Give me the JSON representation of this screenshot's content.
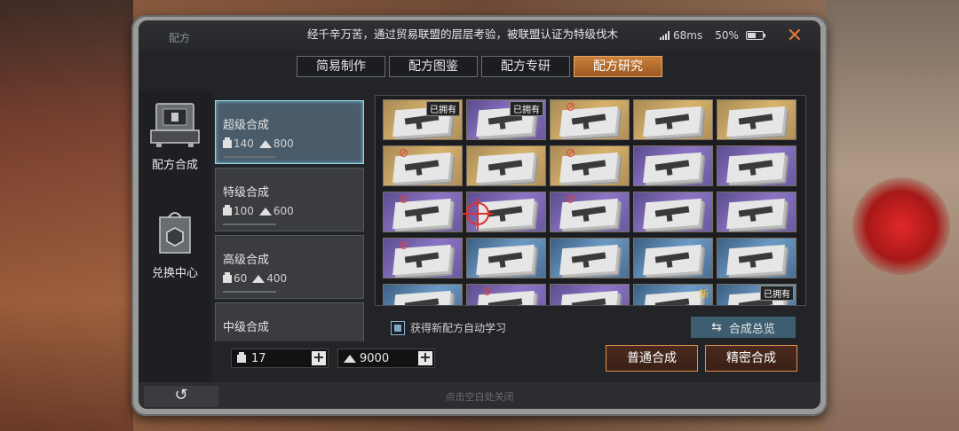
{
  "app": {
    "title": "配方"
  },
  "ticker": "经千辛万苦，通过贸易联盟的层层考验，被联盟认证为特级伐木",
  "status": {
    "ping": "68ms",
    "battery": "50%"
  },
  "close_symbol": "✕",
  "tabs": [
    {
      "label": "简易制作",
      "active": false
    },
    {
      "label": "配方图鉴",
      "active": false
    },
    {
      "label": "配方专研",
      "active": false
    },
    {
      "label": "配方研究",
      "active": true
    }
  ],
  "leftnav": [
    {
      "label": "配方合成",
      "icon": "crafting-machine-icon"
    },
    {
      "label": "兑换中心",
      "icon": "shopping-bag-icon"
    }
  ],
  "recipes": [
    {
      "title": "超级合成",
      "box": "140",
      "pile": "800",
      "active": true
    },
    {
      "title": "特级合成",
      "box": "100",
      "pile": "600",
      "active": false
    },
    {
      "title": "高级合成",
      "box": "60",
      "pile": "400",
      "active": false
    },
    {
      "title": "中级合成",
      "box": "",
      "pile": "",
      "active": false
    }
  ],
  "grid": {
    "cells": [
      {
        "tier": "gold",
        "badge": "已拥有",
        "no_icon": false
      },
      {
        "tier": "purple",
        "badge": "已拥有",
        "no_icon": false
      },
      {
        "tier": "gold",
        "badge": "",
        "no_icon": true
      },
      {
        "tier": "gold",
        "badge": "",
        "no_icon": false
      },
      {
        "tier": "gold",
        "badge": "",
        "no_icon": false
      },
      {
        "tier": "gold",
        "badge": "",
        "no_icon": true
      },
      {
        "tier": "gold",
        "badge": "",
        "no_icon": false
      },
      {
        "tier": "gold",
        "badge": "",
        "no_icon": true
      },
      {
        "tier": "purple",
        "badge": "",
        "no_icon": false
      },
      {
        "tier": "purple",
        "badge": "",
        "no_icon": false
      },
      {
        "tier": "purple",
        "badge": "",
        "no_icon": true
      },
      {
        "tier": "purple",
        "badge": "",
        "no_icon": false
      },
      {
        "tier": "purple",
        "badge": "",
        "no_icon": true
      },
      {
        "tier": "purple",
        "badge": "",
        "no_icon": false
      },
      {
        "tier": "purple",
        "badge": "",
        "no_icon": false
      },
      {
        "tier": "purple",
        "badge": "",
        "no_icon": true
      },
      {
        "tier": "blue",
        "badge": "",
        "no_icon": false
      },
      {
        "tier": "blue",
        "badge": "",
        "no_icon": false
      },
      {
        "tier": "blue",
        "badge": "",
        "no_icon": false
      },
      {
        "tier": "blue",
        "badge": "",
        "no_icon": false
      },
      {
        "tier": "blue",
        "badge": "",
        "no_icon": false
      },
      {
        "tier": "purple",
        "badge": "",
        "no_icon": true
      },
      {
        "tier": "purple",
        "badge": "",
        "no_icon": false
      },
      {
        "tier": "blue",
        "badge": "新",
        "no_icon": false
      },
      {
        "tier": "blue",
        "badge": "已拥有",
        "no_icon": false
      }
    ]
  },
  "auto_learn_label": "获得新配方自动学习",
  "overview": {
    "label": "合成总览",
    "icon_symbol": "⇆"
  },
  "counters": {
    "box_count": "17",
    "pile_count": "9000",
    "plus": "+"
  },
  "actions": {
    "normal_synth": "普通合成",
    "precise_synth": "精密合成"
  },
  "back_symbol": "↺",
  "close_hint": "点击空白处关闭"
}
